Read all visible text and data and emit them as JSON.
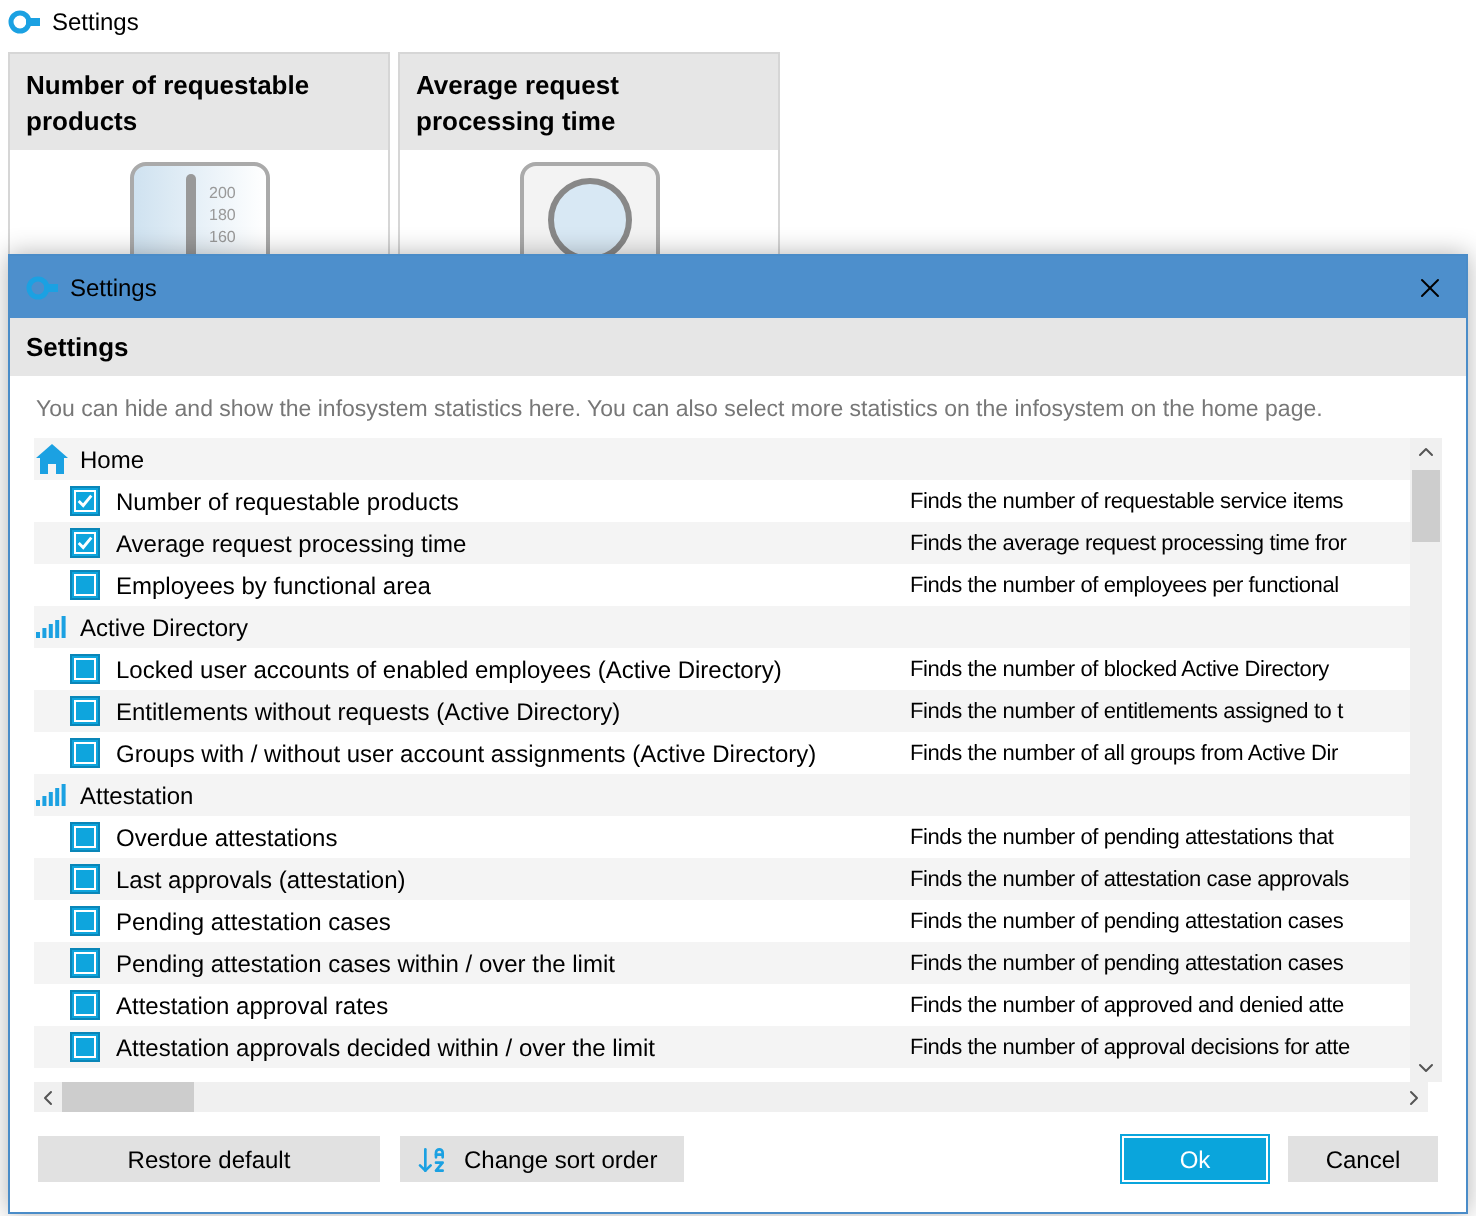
{
  "window": {
    "title": "Settings"
  },
  "tiles": [
    {
      "title": "Number of requestable products",
      "kind": "thermometer",
      "ticks": [
        "200",
        "180",
        "160"
      ]
    },
    {
      "title": "Average request processing time",
      "kind": "dial"
    }
  ],
  "dialog": {
    "title": "Settings",
    "heading": "Settings",
    "description": "You can hide and show the infosystem statistics here. You can also select more statistics on the infosystem on the home page.",
    "groups": [
      {
        "label": "Home",
        "kind": "home",
        "items": [
          {
            "label": "Number of requestable products",
            "checked": true,
            "description": "Finds the number of requestable service items"
          },
          {
            "label": "Average request processing time",
            "checked": true,
            "description": "Finds the average request processing time fror"
          },
          {
            "label": "Employees by functional area",
            "checked": false,
            "description": "Finds the number of employees per functional"
          }
        ]
      },
      {
        "label": "Active Directory",
        "kind": "stats",
        "items": [
          {
            "label": "Locked user accounts of enabled employees (Active Directory)",
            "checked": false,
            "description": "Finds the number of blocked Active Directory"
          },
          {
            "label": "Entitlements without requests (Active Directory)",
            "checked": false,
            "description": "Finds the number of entitlements assigned to t"
          },
          {
            "label": "Groups with / without user account assignments (Active Directory)",
            "checked": false,
            "description": "Finds the number of all groups from Active Dir"
          }
        ]
      },
      {
        "label": "Attestation",
        "kind": "stats",
        "items": [
          {
            "label": "Overdue attestations",
            "checked": false,
            "description": "Finds the number of pending attestations that"
          },
          {
            "label": "Last approvals (attestation)",
            "checked": false,
            "description": "Finds the number of attestation case approvals"
          },
          {
            "label": "Pending attestation cases",
            "checked": false,
            "description": "Finds the number of pending attestation cases"
          },
          {
            "label": "Pending attestation cases within / over the limit",
            "checked": false,
            "description": "Finds the number of pending attestation cases"
          },
          {
            "label": "Attestation approval rates",
            "checked": false,
            "description": "Finds the number of approved and denied atte"
          },
          {
            "label": "Attestation approvals decided within / over the limit",
            "checked": false,
            "description": "Finds the number of approval decisions for atte"
          }
        ]
      }
    ],
    "buttons": [
      {
        "label": "Restore default",
        "kind": "plain",
        "selected": false
      },
      {
        "label": "Change sort order",
        "kind": "sort",
        "selected": false
      },
      {
        "label": "Ok",
        "kind": "spacer-before",
        "selected": true
      },
      {
        "label": "Cancel",
        "kind": "plain",
        "selected": false
      }
    ]
  }
}
